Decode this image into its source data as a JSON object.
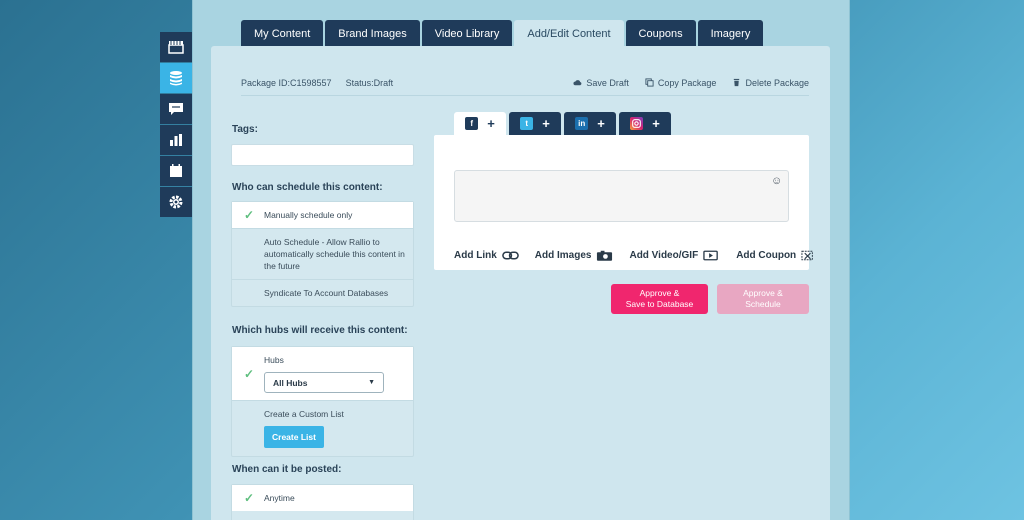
{
  "tabs": [
    {
      "label": "My Content"
    },
    {
      "label": "Brand Images"
    },
    {
      "label": "Video Library"
    },
    {
      "label": "Add/Edit Content"
    },
    {
      "label": "Coupons"
    },
    {
      "label": "Imagery"
    }
  ],
  "package": {
    "id": "Package ID:C1598557",
    "status": "Status:Draft",
    "save_draft": "Save Draft",
    "copy": "Copy Package",
    "delete": "Delete Package"
  },
  "form": {
    "tags_label": "Tags:",
    "schedule_label": "Who can schedule this content:",
    "schedule_options": [
      "Manually schedule only",
      "Auto Schedule - Allow Rallio to automatically schedule this content in the future",
      "Syndicate To Account Databases"
    ],
    "hubs_label": "Which hubs will receive this content:",
    "hubs_title": "Hubs",
    "hubs_select": "All Hubs",
    "custom_list": "Create a Custom List",
    "create_list_button": "Create List",
    "posted_label": "When can it be posted:",
    "posted_option": "Anytime"
  },
  "composer": {
    "add_link": "Add Link",
    "add_images": "Add Images",
    "add_video": "Add Video/GIF",
    "add_coupon": "Add Coupon",
    "plus": "+",
    "networks": {
      "facebook": "f",
      "twitter": "t",
      "linkedin": "in"
    }
  },
  "actions": {
    "approve_save_line1": "Approve &",
    "approve_save_line2": "Save to Database",
    "approve_schedule_line1": "Approve &",
    "approve_schedule_line2": "Schedule"
  },
  "colors": {
    "primary_navy": "#1f3b5a",
    "accent_blue": "#3ab4e6",
    "approve_pink": "#f0266e",
    "approve_disabled": "#e8a7c2",
    "check_green": "#5fbf7f"
  }
}
